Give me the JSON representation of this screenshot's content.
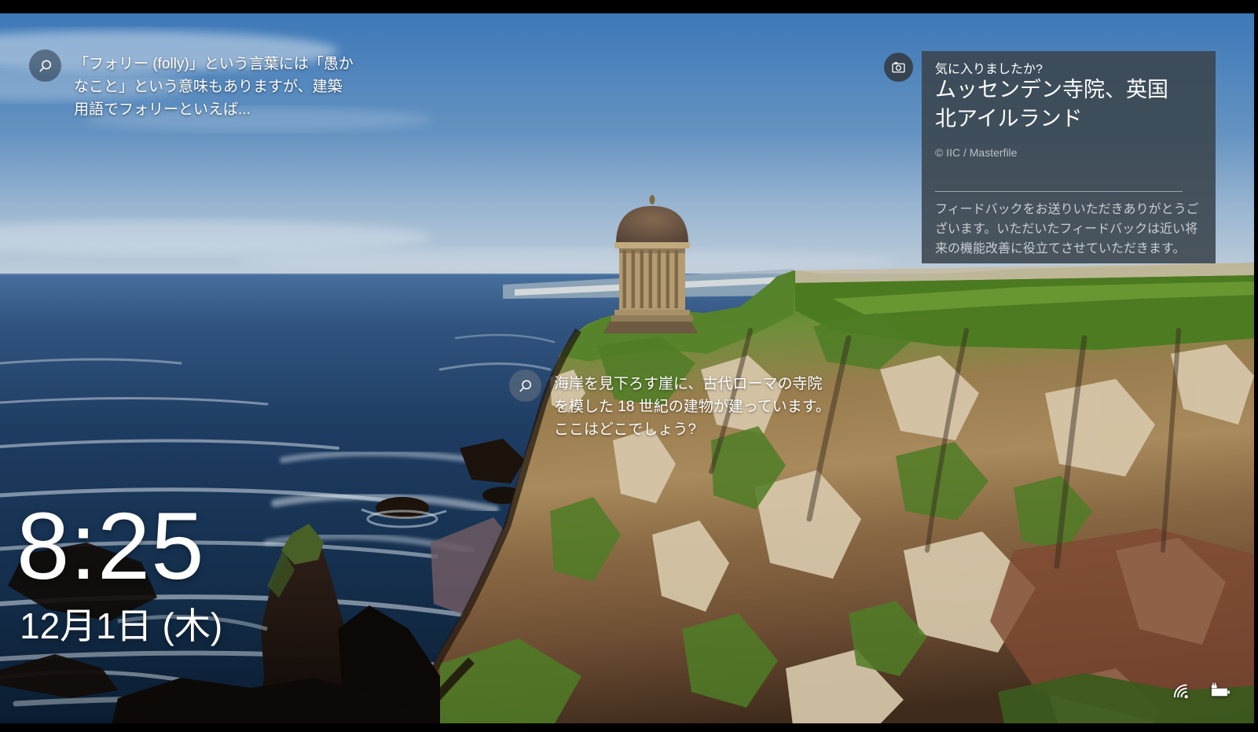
{
  "theme": {
    "panel-bg": "rgba(58,68,76,0.88)",
    "hint-circle-dark": "rgba(25,40,55,0.50)",
    "hint-circle-light": "rgba(120,126,132,0.45)",
    "camera-circle": "rgba(52,62,70,0.92)",
    "text-primary": "#ffffff",
    "text-credit": "#b9c0c6",
    "text-feedback": "#c9ced3",
    "divider": "#9aa2a8"
  },
  "hints": {
    "top_left": {
      "icon": "search-icon",
      "text": "「フォリー (folly)」という言葉には「愚かなこと」という意味もありますが、建築用語でフォリーといえば..."
    },
    "center": {
      "icon": "search-icon",
      "text": "海岸を見下ろす崖に、古代ローマの寺院を模した 18 世紀の建物が建っています。ここはどこでしょう?"
    }
  },
  "spotlight": {
    "icon": "camera-icon",
    "question": "気に入りましたか?",
    "title": "ムッセンデン寺院、英国北アイルランド",
    "credit": "© IIC / Masterfile",
    "feedback_message": "フィードバックをお送りいただきありがとうございます。いただいたフィードバックは近い将来の機能改善に役立てさせていただきます。"
  },
  "clock": {
    "time": "8:25",
    "date": "12月1日 (木)"
  },
  "status_icons": {
    "wifi": "wifi-icon",
    "battery": "battery-charging-icon"
  }
}
